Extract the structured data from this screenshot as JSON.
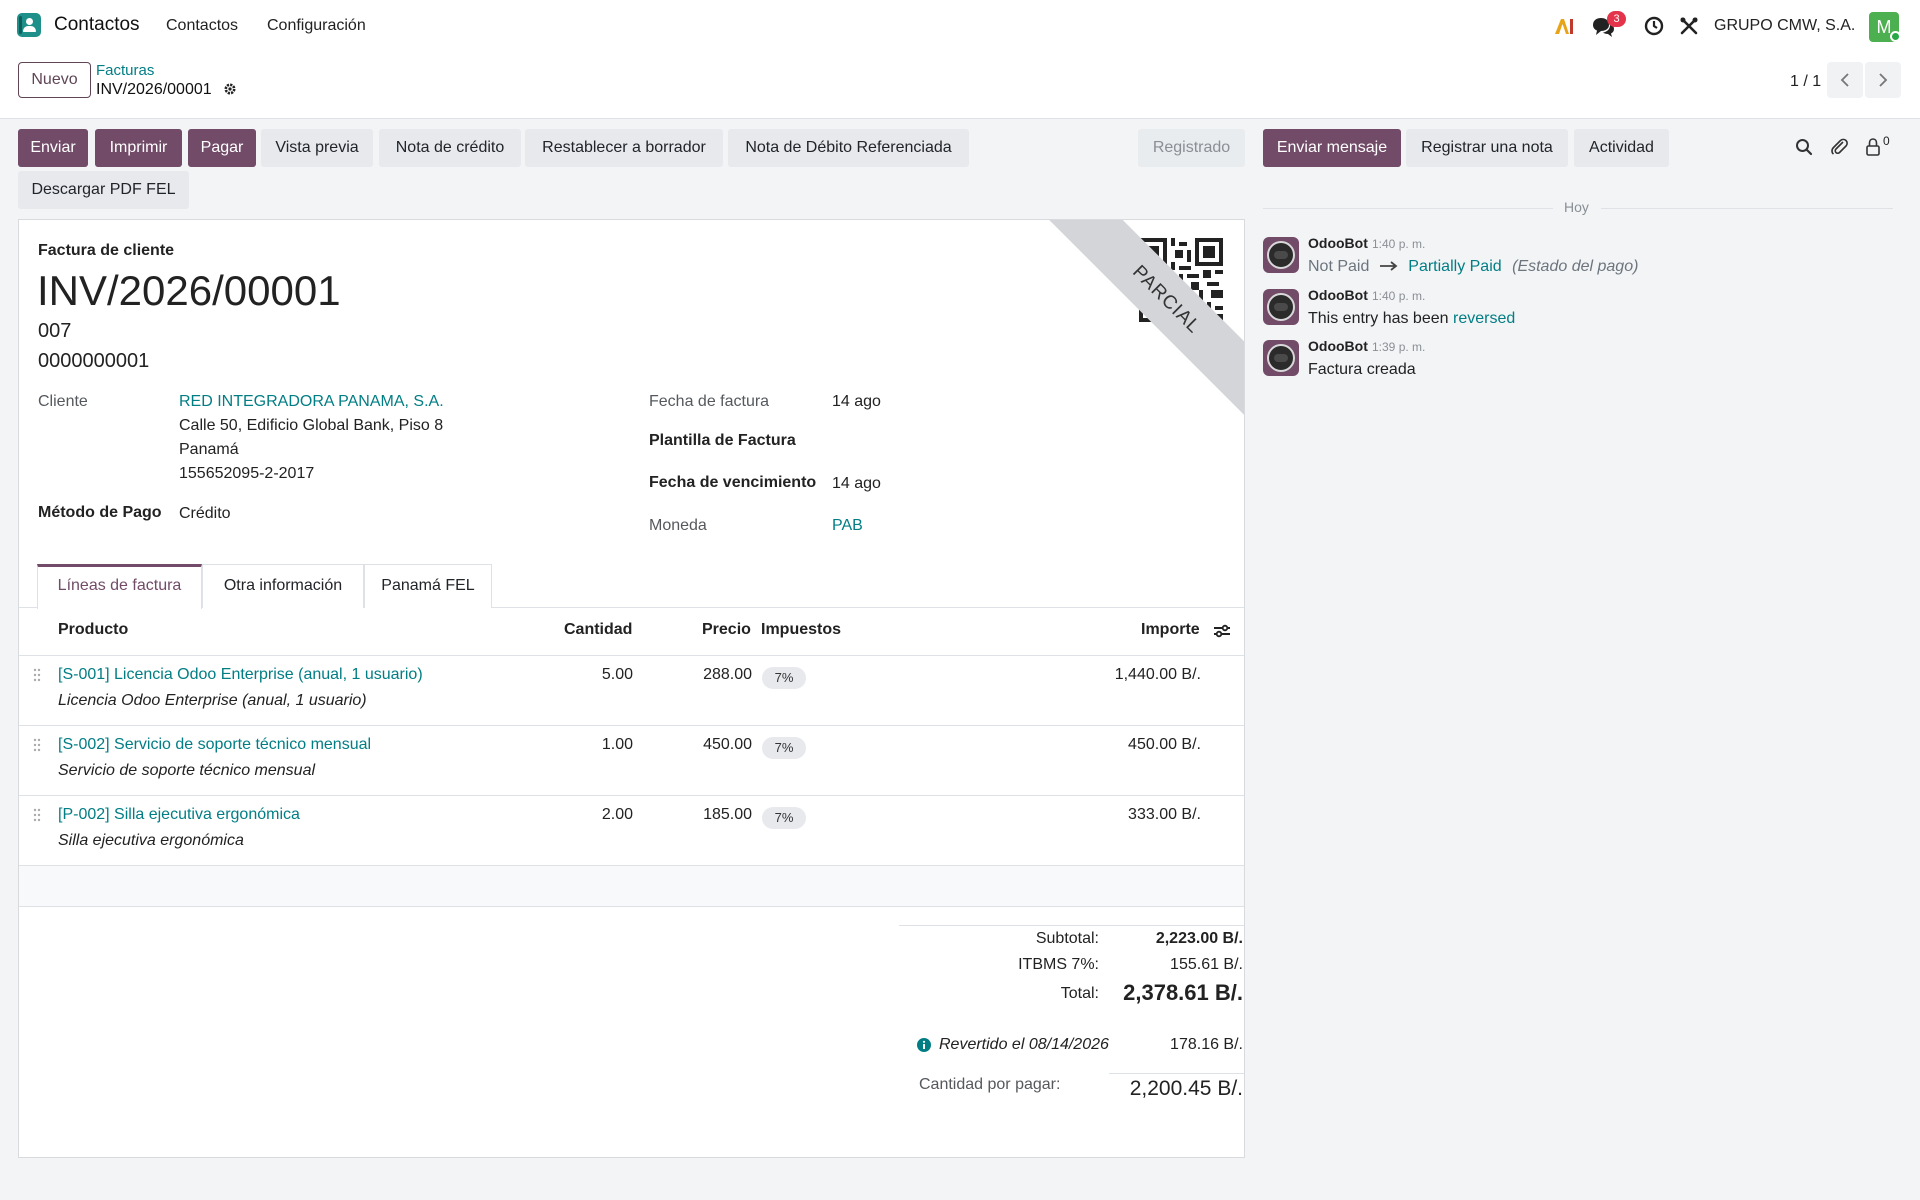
{
  "navbar": {
    "app_name": "Contactos",
    "menu": [
      "Contactos",
      "Configuración"
    ],
    "messages_badge": "3",
    "company": "GRUPO CMW, S.A.",
    "avatar_letter": "M"
  },
  "control": {
    "new_button": "Nuevo",
    "breadcrumb_parent": "Facturas",
    "breadcrumb_current": "INV/2026/00001",
    "pager": "1 / 1"
  },
  "actions": {
    "buttons": [
      "Enviar",
      "Imprimir",
      "Pagar",
      "Vista previa",
      "Nota de crédito",
      "Restablecer a borrador",
      "Nota de Débito Referenciada",
      "Descargar PDF FEL"
    ],
    "status": "Registrado"
  },
  "chatter": {
    "send_message": "Enviar mensaje",
    "log_note": "Registrar una nota",
    "activity": "Actividad",
    "followers_count": "0",
    "day_label": "Hoy",
    "messages": [
      {
        "author": "OdooBot",
        "time": "1:40 p. m.",
        "from": "Not Paid",
        "to": "Partially Paid",
        "field": "(Estado del pago)"
      },
      {
        "author": "OdooBot",
        "time": "1:40 p. m.",
        "text": "This entry has been",
        "link": "reversed"
      },
      {
        "author": "OdooBot",
        "time": "1:39 p. m.",
        "text": "Factura creada"
      }
    ]
  },
  "invoice": {
    "ribbon": "PARCIAL",
    "type_label": "Factura de cliente",
    "number": "INV/2026/00001",
    "line2": "007",
    "line3": "0000000001",
    "customer_label": "Cliente",
    "customer_name": "RED INTEGRADORA PANAMA, S.A.",
    "customer_addr1": "Calle 50, Edificio Global Bank, Piso 8",
    "customer_addr2": "Panamá",
    "customer_ruc": "155652095-2-2017",
    "payment_method_label": "Método de Pago",
    "payment_method": "Crédito",
    "invoice_date_label": "Fecha de factura",
    "invoice_date": "14 ago",
    "template_label": "Plantilla de Factura",
    "due_date_label": "Fecha de vencimiento",
    "due_date": "14 ago",
    "currency_label": "Moneda",
    "currency": "PAB",
    "tabs": [
      "Líneas de factura",
      "Otra información",
      "Panamá FEL"
    ],
    "columns": {
      "product": "Producto",
      "quantity": "Cantidad",
      "price": "Precio",
      "taxes": "Impuestos",
      "amount": "Importe"
    },
    "lines": [
      {
        "product": "[S-001] Licencia Odoo Enterprise (anual, 1 usuario)",
        "description": "Licencia Odoo Enterprise (anual, 1 usuario)",
        "quantity": "5.00",
        "price": "288.00",
        "tax": "7%",
        "amount": "1,440.00 B/."
      },
      {
        "product": "[S-002] Servicio de soporte técnico mensual",
        "description": "Servicio de soporte técnico mensual",
        "quantity": "1.00",
        "price": "450.00",
        "tax": "7%",
        "amount": "450.00 B/."
      },
      {
        "product": "[P-002] Silla ejecutiva ergonómica",
        "description": "Silla ejecutiva ergonómica",
        "quantity": "2.00",
        "price": "185.00",
        "tax": "7%",
        "amount": "333.00 B/."
      }
    ],
    "totals": {
      "subtotal_label": "Subtotal:",
      "subtotal": "2,223.00 B/.",
      "tax_label": "ITBMS 7%:",
      "tax": "155.61 B/.",
      "total_label": "Total:",
      "total": "2,378.61 B/.",
      "reversed_label": "Revertido el 08/14/2026",
      "reversed_amount": "178.16 B/.",
      "due_label": "Cantidad por pagar:",
      "due": "2,200.45 B/."
    }
  },
  "colors": {
    "primary": "#714b67",
    "link": "#017e84",
    "badge": "#e3344b"
  }
}
